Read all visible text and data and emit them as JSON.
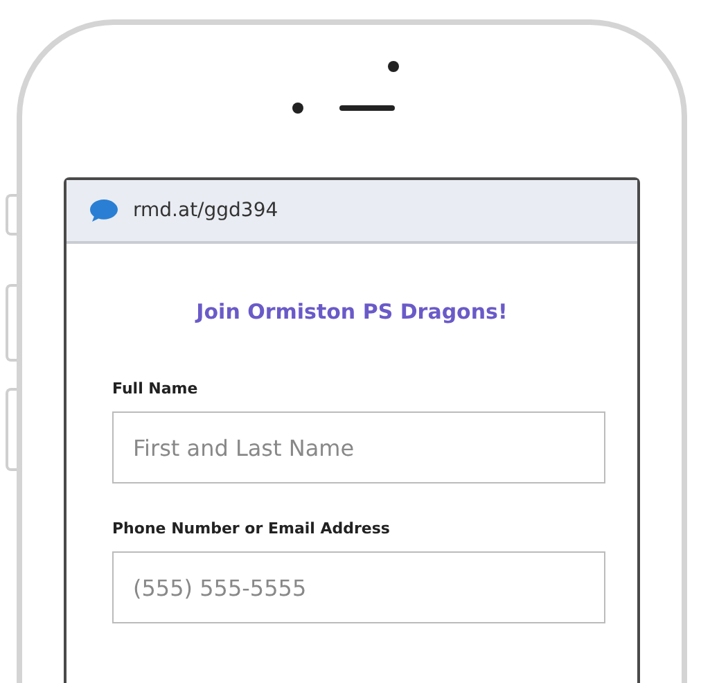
{
  "browser": {
    "url": "rmd.at/ggd394"
  },
  "form": {
    "title": "Join Ormiston PS Dragons!",
    "fields": [
      {
        "label": "Full Name",
        "placeholder": "First and Last Name"
      },
      {
        "label": "Phone Number or Email Address",
        "placeholder": "(555) 555-5555"
      }
    ]
  }
}
